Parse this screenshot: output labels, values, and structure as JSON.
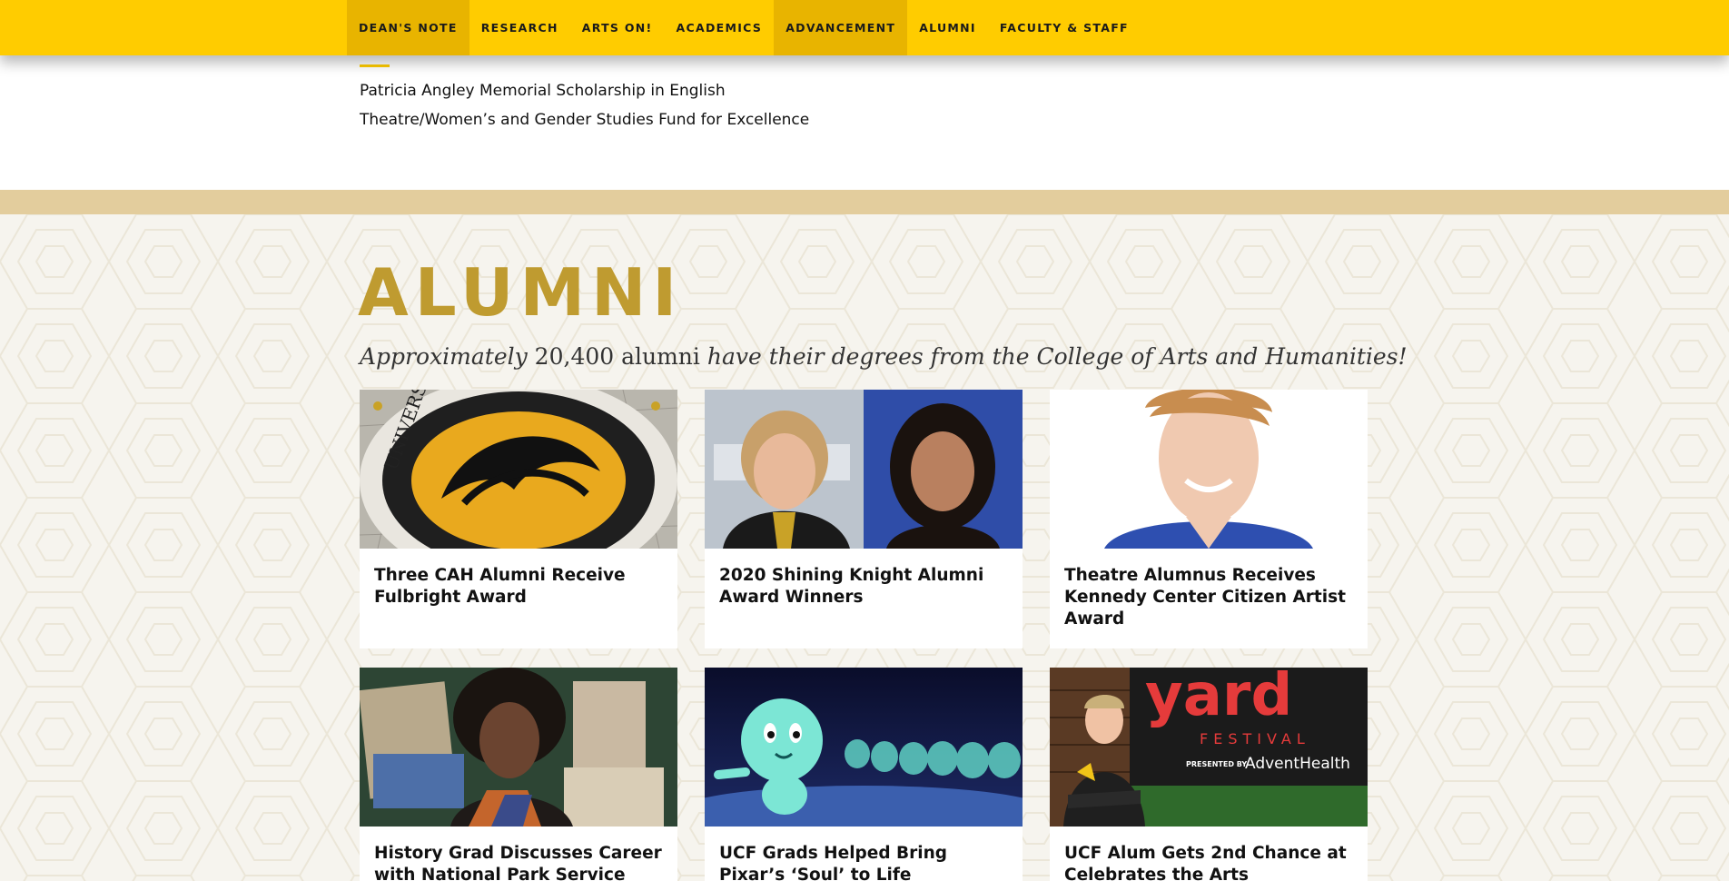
{
  "nav": {
    "items": [
      {
        "label": "DEAN'S NOTE",
        "active": true
      },
      {
        "label": "RESEARCH",
        "active": false
      },
      {
        "label": "ARTS ON!",
        "active": false
      },
      {
        "label": "ACADEMICS",
        "active": false
      },
      {
        "label": "ADVANCEMENT",
        "active": true
      },
      {
        "label": "ALUMNI",
        "active": false
      },
      {
        "label": "FACULTY & STAFF",
        "active": false
      }
    ]
  },
  "funds": {
    "links": [
      "Patricia Angley Memorial Scholarship in English",
      "Theatre/Women’s and Gender Studies Fund for Excellence"
    ]
  },
  "alumni": {
    "title": "ALUMNI",
    "subtitle_part1": "Approximately",
    "subtitle_count": " 20,400 alumni ",
    "subtitle_part2": "have their degrees from the College of Arts and Humanities!",
    "cards": [
      {
        "title": "Three CAH Alumni Receive Fulbright Award",
        "image": "ucf-seal-floor"
      },
      {
        "title": "2020 Shining Knight Alumni Award Winners",
        "image": "two-alumni-portraits"
      },
      {
        "title": "Theatre Alumnus Receives Kennedy Center Citizen Artist Award",
        "image": "young-man-portrait"
      },
      {
        "title": "History Grad Discusses Career with National Park Service",
        "image": "historian-collage"
      },
      {
        "title": "UCF Grads Helped Bring Pixar’s ‘Soul’ to Life",
        "image": "pixar-soul-characters"
      },
      {
        "title": "UCF Alum Gets 2nd Chance at Celebrates the Arts",
        "image": "front-yard-festival"
      }
    ],
    "front_yard_sign": {
      "line1": "yard",
      "line2": "FESTIVAL",
      "presented_by": "PRESENTED BY",
      "sponsor": "AdventHealth"
    }
  },
  "colors": {
    "nav_bg": "#ffcc00",
    "nav_active": "#e8b400",
    "band": "#e3cd9d",
    "title_gold": "#bf9b30",
    "section_bg": "#f6f4ee"
  }
}
